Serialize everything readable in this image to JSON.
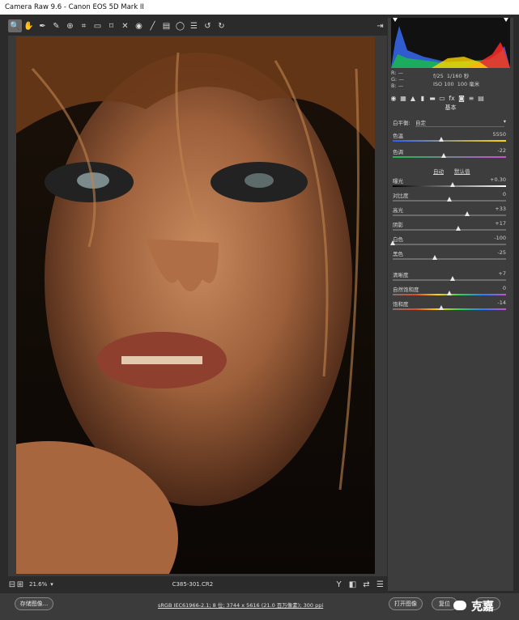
{
  "window": {
    "title": "Camera Raw 9.6 -  Canon EOS 5D Mark II"
  },
  "toolbar": {
    "icons": [
      "zoom-icon",
      "hand-icon",
      "white-balance-icon",
      "color-sampler-icon",
      "target-adjust-icon",
      "crop-icon",
      "straighten-icon",
      "transform-icon",
      "spot-removal-icon",
      "red-eye-icon",
      "adjustment-brush-icon",
      "graduated-filter-icon",
      "radial-filter-icon",
      "preferences-icon",
      "rotate-ccw-icon",
      "rotate-cw-icon"
    ],
    "open_panel_icon": "open-panel-icon"
  },
  "histogram": {
    "r_label": "R:",
    "g_label": "G:",
    "b_label": "B:",
    "r_value": "—",
    "g_value": "—",
    "b_value": "—",
    "aperture": "f/25",
    "shutter": "1/160 秒",
    "iso": "ISO 100",
    "focal": "100 毫米"
  },
  "panel_tabs": [
    "basic-tab-icon",
    "tone-curve-tab-icon",
    "detail-tab-icon",
    "hsl-tab-icon",
    "split-toning-tab-icon",
    "lens-tab-icon",
    "fx-tab-icon",
    "camera-calibration-tab-icon",
    "presets-tab-icon",
    "snapshots-tab-icon"
  ],
  "basic": {
    "section_title": "基本",
    "white_balance": {
      "label": "白平衡:",
      "value": "自定"
    },
    "temp": {
      "label": "色温",
      "value": "5550",
      "pos": 0.43
    },
    "tint": {
      "label": "色调",
      "value": "-22",
      "pos": 0.45
    },
    "auto": "自动",
    "default": "默认值",
    "exposure": {
      "label": "曝光",
      "value": "+0.30",
      "pos": 0.53
    },
    "contrast": {
      "label": "对比度",
      "value": "0",
      "pos": 0.5
    },
    "highlights": {
      "label": "高光",
      "value": "+33",
      "pos": 0.66
    },
    "shadows": {
      "label": "阴影",
      "value": "+17",
      "pos": 0.58
    },
    "whites": {
      "label": "白色",
      "value": "-100",
      "pos": 0.0
    },
    "blacks": {
      "label": "黑色",
      "value": "-25",
      "pos": 0.37
    },
    "clarity": {
      "label": "清晰度",
      "value": "+7",
      "pos": 0.53
    },
    "vibrance": {
      "label": "自然饱和度",
      "value": "0",
      "pos": 0.5
    },
    "saturation": {
      "label": "饱和度",
      "value": "-14",
      "pos": 0.43
    }
  },
  "status": {
    "zoom": "21.6%",
    "filename": "C385-301.CR2",
    "view_icons": [
      "y-icon",
      "before-after-icon",
      "swap-icon",
      "settings-icon"
    ]
  },
  "bottom": {
    "save_label": "存储图像...",
    "workflow": "sRGB IEC61966-2.1; 8 位; 3744 x 5616 (21.0 百万像素); 300 ppi",
    "open_label": "打开图像",
    "reset_label": "复位",
    "done_label": "完成",
    "watermark": "克嘉"
  },
  "colors": {
    "bg": "#2b2b2b",
    "panel": "#3d3d3d",
    "accent": "#e8e8e8"
  }
}
